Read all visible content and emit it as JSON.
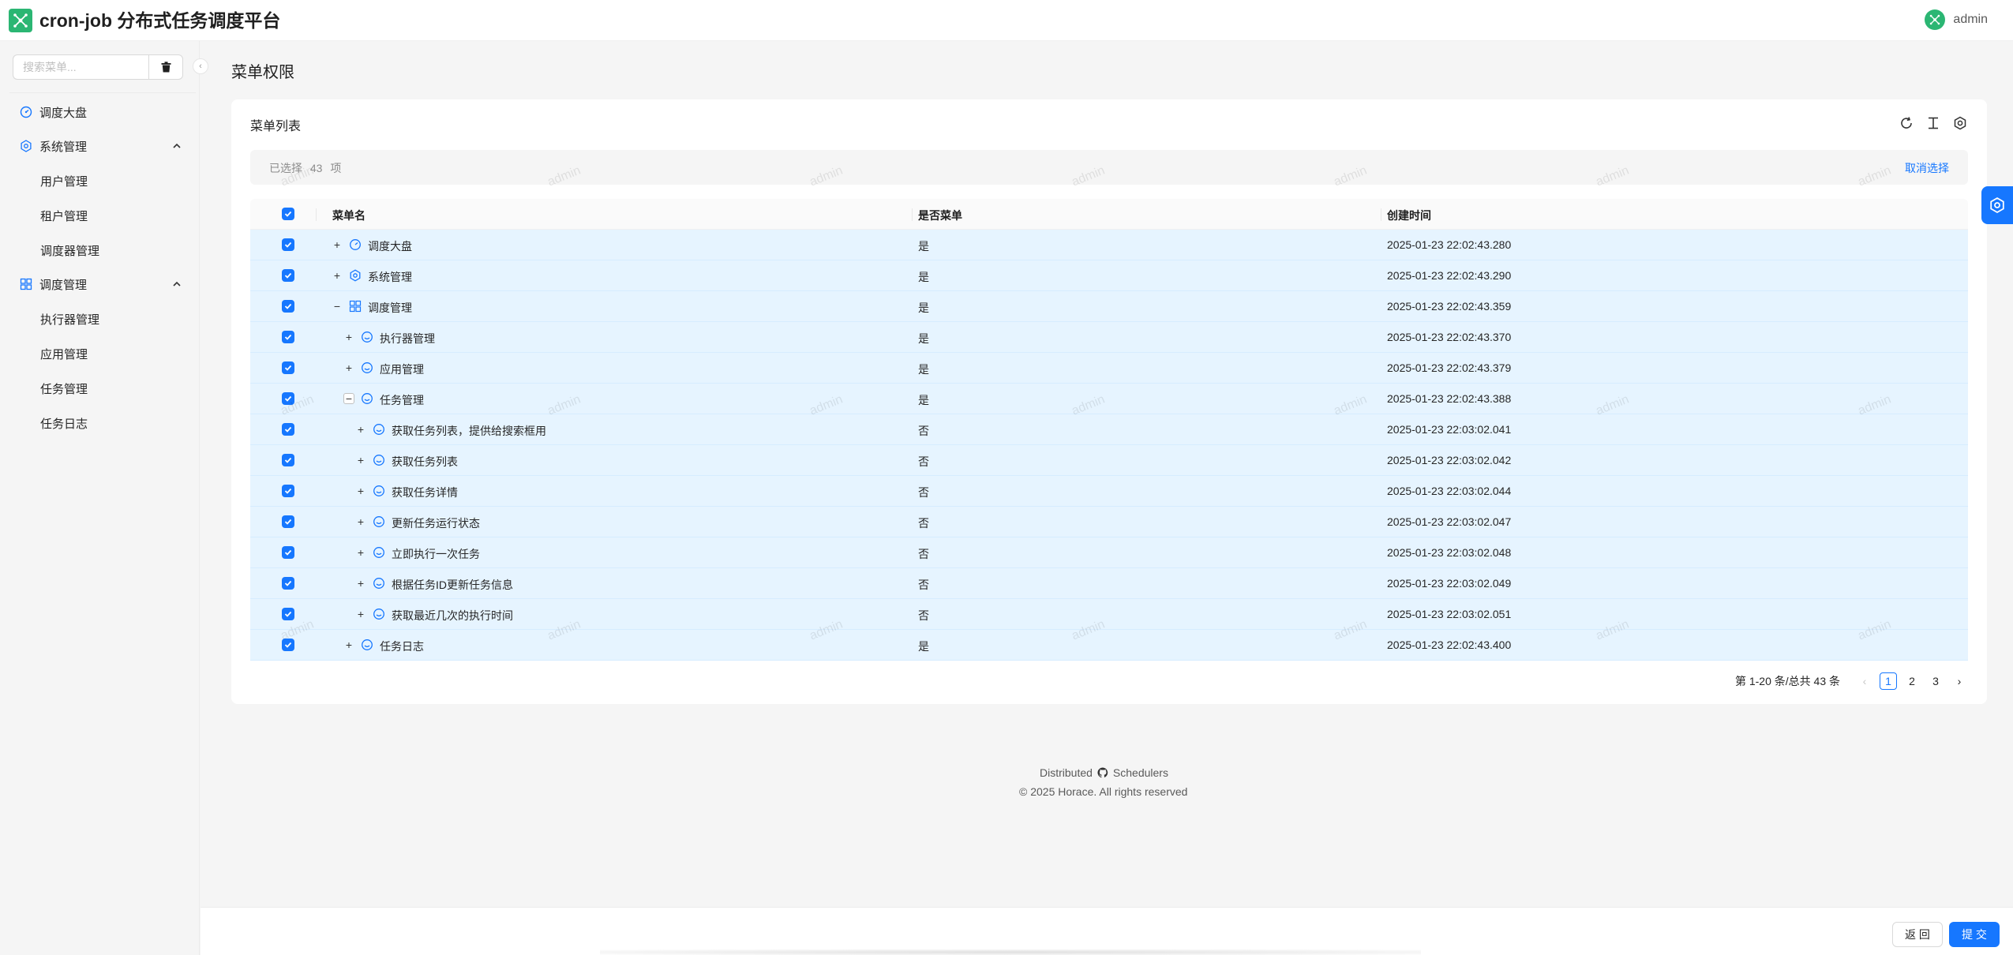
{
  "app": {
    "title": "cron-job 分布式任务调度平台",
    "user": "admin",
    "brand_color": "#2bb673",
    "accent_color": "#1677ff"
  },
  "sidebar": {
    "search_placeholder": "搜索菜单...",
    "search_value": "",
    "clear_icon": "trash-icon",
    "items": [
      {
        "label": "调度大盘",
        "icon": "dashboard-icon"
      },
      {
        "label": "系统管理",
        "icon": "settings-icon",
        "expanded": true,
        "children": [
          "用户管理",
          "租户管理",
          "调度器管理"
        ]
      },
      {
        "label": "调度管理",
        "icon": "grid-icon",
        "expanded": true,
        "children": [
          "执行器管理",
          "应用管理",
          "任务管理",
          "任务日志"
        ]
      }
    ]
  },
  "main": {
    "page_title": "菜单权限",
    "card_title": "菜单列表",
    "toolbar": [
      "reload-icon",
      "column-height-icon",
      "setting-icon"
    ],
    "selection": {
      "prefix": "已选择",
      "count": "43",
      "suffix": "项",
      "cancel_label": "取消选择"
    },
    "table": {
      "columns": [
        "菜单名",
        "是否菜单",
        "创建时间"
      ],
      "rows": [
        {
          "name": "调度大盘",
          "is_menu": "是",
          "created": "2025-01-23 22:02:43.280",
          "level": 0,
          "expand": "+",
          "icon": "dashboard-icon"
        },
        {
          "name": "系统管理",
          "is_menu": "是",
          "created": "2025-01-23 22:02:43.290",
          "level": 0,
          "expand": "+",
          "icon": "settings-icon"
        },
        {
          "name": "调度管理",
          "is_menu": "是",
          "created": "2025-01-23 22:02:43.359",
          "level": 0,
          "expand": "−",
          "icon": "grid-icon"
        },
        {
          "name": "执行器管理",
          "is_menu": "是",
          "created": "2025-01-23 22:02:43.370",
          "level": 1,
          "expand": "+",
          "icon": "smile-icon"
        },
        {
          "name": "应用管理",
          "is_menu": "是",
          "created": "2025-01-23 22:02:43.379",
          "level": 1,
          "expand": "+",
          "icon": "smile-icon"
        },
        {
          "name": "任务管理",
          "is_menu": "是",
          "created": "2025-01-23 22:02:43.388",
          "level": 1,
          "expand": "−",
          "icon": "smile-icon",
          "boxed": true
        },
        {
          "name": "获取任务列表，提供给搜索框用",
          "is_menu": "否",
          "created": "2025-01-23 22:03:02.041",
          "level": 2,
          "expand": "+",
          "icon": "smile-icon"
        },
        {
          "name": "获取任务列表",
          "is_menu": "否",
          "created": "2025-01-23 22:03:02.042",
          "level": 2,
          "expand": "+",
          "icon": "smile-icon"
        },
        {
          "name": "获取任务详情",
          "is_menu": "否",
          "created": "2025-01-23 22:03:02.044",
          "level": 2,
          "expand": "+",
          "icon": "smile-icon"
        },
        {
          "name": "更新任务运行状态",
          "is_menu": "否",
          "created": "2025-01-23 22:03:02.047",
          "level": 2,
          "expand": "+",
          "icon": "smile-icon"
        },
        {
          "name": "立即执行一次任务",
          "is_menu": "否",
          "created": "2025-01-23 22:03:02.048",
          "level": 2,
          "expand": "+",
          "icon": "smile-icon"
        },
        {
          "name": "根据任务ID更新任务信息",
          "is_menu": "否",
          "created": "2025-01-23 22:03:02.049",
          "level": 2,
          "expand": "+",
          "icon": "smile-icon"
        },
        {
          "name": "获取最近几次的执行时间",
          "is_menu": "否",
          "created": "2025-01-23 22:03:02.051",
          "level": 2,
          "expand": "+",
          "icon": "smile-icon"
        },
        {
          "name": "任务日志",
          "is_menu": "是",
          "created": "2025-01-23 22:02:43.400",
          "level": 1,
          "expand": "+",
          "icon": "smile-icon"
        }
      ]
    },
    "pagination": {
      "total_text": "第 1-20 条/总共 43 条",
      "pages": [
        "1",
        "2",
        "3"
      ],
      "current": "1",
      "prev": "‹",
      "next": "›"
    },
    "watermark": "admin"
  },
  "footer": {
    "left": "Distributed",
    "right": "Schedulers",
    "copyright": "2025 Horace. All rights reserved",
    "github_icon": "github-icon"
  },
  "actions": {
    "back_label": "返 回",
    "submit_label": "提 交"
  }
}
